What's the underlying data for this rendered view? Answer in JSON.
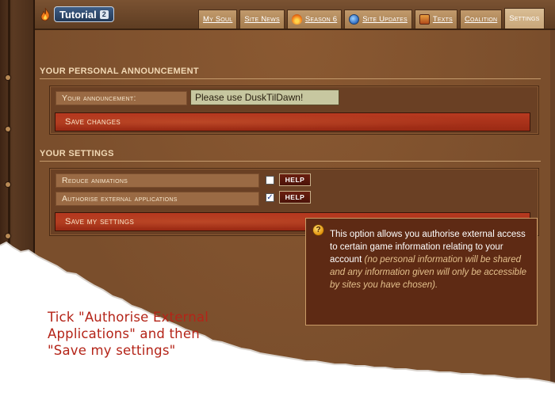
{
  "header": {
    "logo_text": "Tutorial",
    "logo_badge": "2",
    "tabs": [
      {
        "label": "My Soul",
        "icon": "",
        "active": false
      },
      {
        "label": "Site News",
        "icon": "",
        "active": false
      },
      {
        "label": "Season 6",
        "icon": "flame-icon",
        "active": false
      },
      {
        "label": "Site Updates",
        "icon": "globe-icon",
        "active": false
      },
      {
        "label": "Texts",
        "icon": "texts-icon",
        "active": false
      },
      {
        "label": "Coalition",
        "icon": "",
        "active": false
      },
      {
        "label": "Settings",
        "icon": "",
        "active": true
      }
    ]
  },
  "announcement": {
    "section_title": "YOUR PERSONAL ANNOUNCEMENT",
    "field_label": "Your announcement:",
    "field_value": "Please use DuskTilDawn!",
    "save_label": "Save changes"
  },
  "settings": {
    "section_title": "YOUR SETTINGS",
    "rows": [
      {
        "label": "Reduce animations",
        "checked": false,
        "check_mark": "",
        "help_label": "HELP"
      },
      {
        "label": "Authorise external applications",
        "checked": true,
        "check_mark": "✓",
        "help_label": "HELP"
      }
    ],
    "save_label": "Save my settings"
  },
  "tooltip": {
    "icon_glyph": "?",
    "main_text": "This option allows you authorise external access to certain game information relating to your account",
    "note_text": "(no personal information will be shared and any information given will only be accessible by sites you have chosen)."
  },
  "instruction": {
    "text": "Tick \"Authorise External Applications\" and then \"Save my  settings\""
  },
  "colors": {
    "instruction_text": "#b42418",
    "button_red": "#9a2a14",
    "tooltip_bg": "#5e2a14"
  }
}
